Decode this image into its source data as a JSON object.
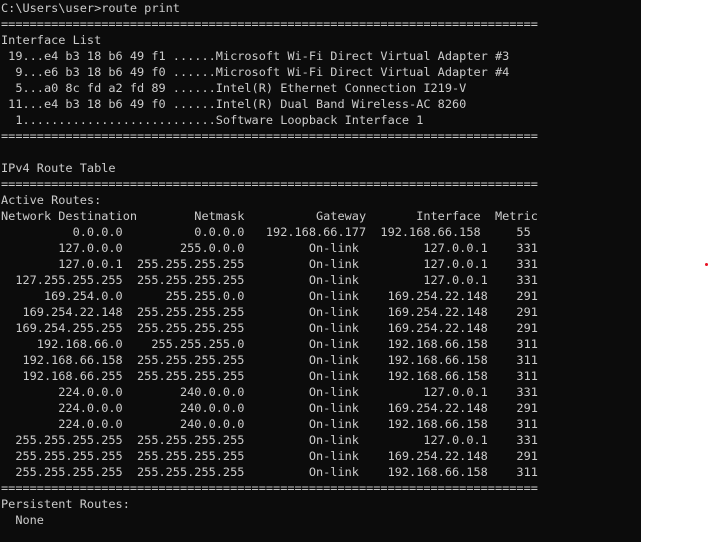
{
  "console": {
    "lines": [
      "C:\\Users\\user>route print",
      "===========================================================================",
      "Interface List",
      " 19...e4 b3 18 b6 49 f1 ......Microsoft Wi-Fi Direct Virtual Adapter #3",
      "  9...e6 b3 18 b6 49 f0 ......Microsoft Wi-Fi Direct Virtual Adapter #4",
      "  5...a0 8c fd a2 fd 89 ......Intel(R) Ethernet Connection I219-V",
      " 11...e4 b3 18 b6 49 f0 ......Intel(R) Dual Band Wireless-AC 8260",
      "  1...........................Software Loopback Interface 1",
      "===========================================================================",
      "",
      "IPv4 Route Table",
      "===========================================================================",
      "Active Routes:",
      "Network Destination        Netmask          Gateway       Interface  Metric",
      "          0.0.0.0          0.0.0.0   192.168.66.177  192.168.66.158     55",
      "        127.0.0.0        255.0.0.0         On-link         127.0.0.1    331",
      "        127.0.0.1  255.255.255.255         On-link         127.0.0.1    331",
      "  127.255.255.255  255.255.255.255         On-link         127.0.0.1    331",
      "      169.254.0.0      255.255.0.0         On-link    169.254.22.148    291",
      "   169.254.22.148  255.255.255.255         On-link    169.254.22.148    291",
      "  169.254.255.255  255.255.255.255         On-link    169.254.22.148    291",
      "     192.168.66.0    255.255.255.0         On-link    192.168.66.158    311",
      "   192.168.66.158  255.255.255.255         On-link    192.168.66.158    311",
      "   192.168.66.255  255.255.255.255         On-link    192.168.66.158    311",
      "        224.0.0.0        240.0.0.0         On-link         127.0.0.1    331",
      "        224.0.0.0        240.0.0.0         On-link    169.254.22.148    291",
      "        224.0.0.0        240.0.0.0         On-link    192.168.66.158    311",
      "  255.255.255.255  255.255.255.255         On-link         127.0.0.1    331",
      "  255.255.255.255  255.255.255.255         On-link    169.254.22.148    291",
      "  255.255.255.255  255.255.255.255         On-link    192.168.66.158    311",
      "===========================================================================",
      "Persistent Routes:",
      "  None"
    ]
  },
  "colors": {
    "console_background": "#0c0c0c",
    "console_text": "#cccccc",
    "page_background": "#ffffff",
    "dot": "#e81123"
  }
}
